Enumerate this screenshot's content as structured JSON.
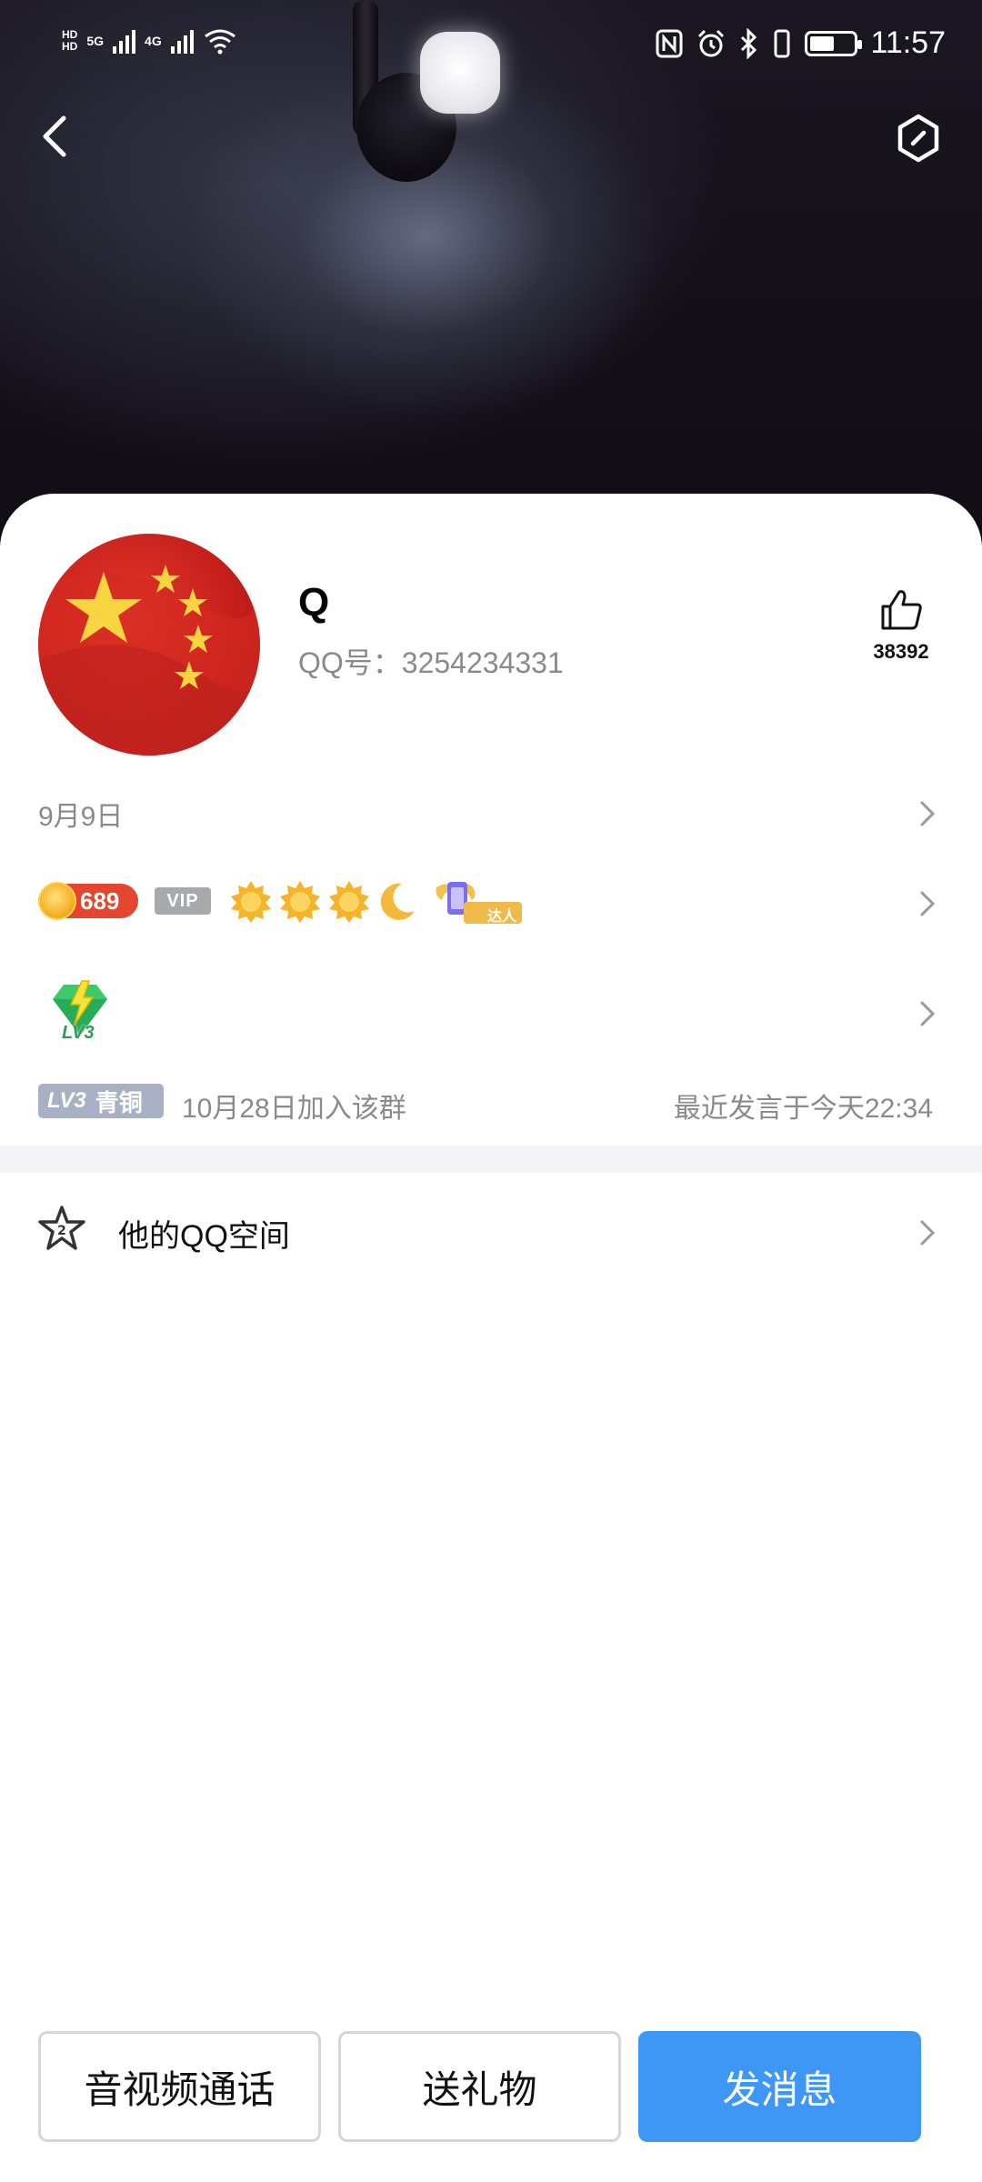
{
  "status_bar": {
    "network_1": "5G",
    "network_2": "4G",
    "time": "11:57",
    "battery_level": 0.55
  },
  "profile": {
    "name": "Q",
    "qq_number": "QQ号：3254234331",
    "likes": "38392",
    "birthday": "9月9日"
  },
  "badges": {
    "coins": "689",
    "vip_label": "VIP",
    "daren_label": "达人",
    "sun_count": 3
  },
  "level": {
    "gem_label": "LV3"
  },
  "group": {
    "level_prefix": "LV3",
    "level_name": "青铜",
    "joined": "10月28日加入该群",
    "last_message": "最近发言于今天22:34"
  },
  "qzone": {
    "label": "他的QQ空间",
    "icon_badge": "2"
  },
  "actions": {
    "call": "音视频通话",
    "gift": "送礼物",
    "message": "发消息"
  },
  "colors": {
    "accent": "#3f97f5",
    "coin_red": "#e3452e",
    "gray_text": "#8a8a8a",
    "tag_gray": "#a8b0c4"
  }
}
